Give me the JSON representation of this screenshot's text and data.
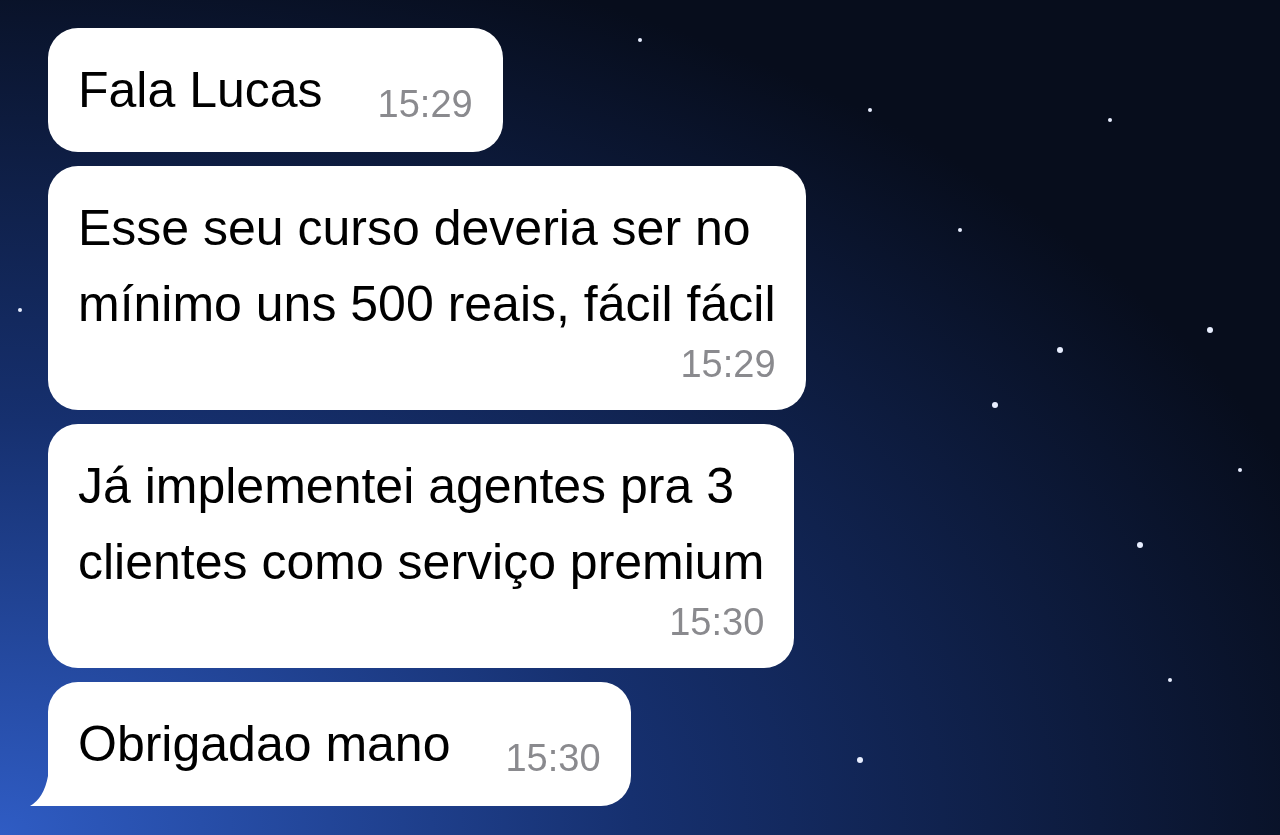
{
  "messages": [
    {
      "lines": [
        "Fala Lucas"
      ],
      "time": "15:29",
      "tail": false
    },
    {
      "lines": [
        "Esse seu curso deveria ser no",
        "mínimo uns 500 reais, fácil fácil"
      ],
      "time": "15:29",
      "tail": false
    },
    {
      "lines": [
        "Já implementei agentes pra 3",
        "clientes como serviço premium"
      ],
      "time": "15:30",
      "tail": false
    },
    {
      "lines": [
        "Obrigadao mano"
      ],
      "time": "15:30",
      "tail": true
    }
  ]
}
